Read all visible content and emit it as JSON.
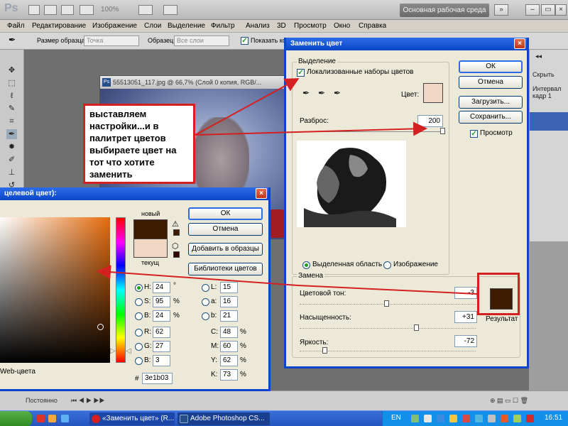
{
  "app": {
    "logo": "Ps",
    "zoom": "100%",
    "workspace": "Основная рабочая среда"
  },
  "menu": [
    "Файл",
    "Редактирование",
    "Изображение",
    "Слои",
    "Выделение",
    "Фильтр",
    "Анализ",
    "3D",
    "Просмотр",
    "Окно",
    "Справка"
  ],
  "options": {
    "sample_size_label": "Размер образца:",
    "sample_size_value": "Точка",
    "sample_label": "Образец:",
    "sample_value": "Все слои",
    "show_label": "Показать кол"
  },
  "document": {
    "title": "55513051_117.jpg @ 66,7% (Слой 0 копия, RGB/..."
  },
  "right_panel": {
    "hide": "Скрыть",
    "frame": "Интервал кадр 1"
  },
  "bottom_strip": {
    "loop": "Постоянно"
  },
  "replace_dialog": {
    "title": "Заменить цвет",
    "selection_group": "Выделение",
    "localized_label": "Локализованные наборы цветов",
    "color_label": "Цвет:",
    "color_hex": "#f2d8c4",
    "fuzziness_label": "Разброс:",
    "fuzziness_value": "200",
    "fuzziness_percent": 1.0,
    "radio_selection": "Выделенная область",
    "radio_image": "Изображение",
    "replace_group": "Замена",
    "hue_label": "Цветовой тон:",
    "hue_value": "-3",
    "hue_slider": 0.49,
    "sat_label": "Насыщенность:",
    "sat_value": "+31",
    "sat_slider": 0.66,
    "light_label": "Яркость:",
    "light_value": "-72",
    "light_slider": 0.14,
    "result_label": "Результат",
    "result_hex": "#3e1b03",
    "ok": "ОК",
    "cancel": "Отмена",
    "load": "Загрузить...",
    "save": "Сохранить...",
    "preview": "Просмотр"
  },
  "picker_dialog": {
    "title": "цвет цвет (целевой цвет):",
    "title_visible": "целевой цвет):",
    "new_label": "новый",
    "current_label": "текущ",
    "new_hex": "#3e1b03",
    "current_hex": "#f2d8c4",
    "ok": "ОК",
    "cancel": "Отмена",
    "add_swatches": "Добавить в образцы",
    "libraries": "Библиотеки цветов",
    "web_only": "Web-цвета",
    "h": "24",
    "h_unit": "°",
    "s": "95",
    "s_unit": "%",
    "b": "24",
    "b_unit": "%",
    "r": "62",
    "g": "27",
    "b2": "3",
    "l": "15",
    "a": "16",
    "b3": "21",
    "c": "48",
    "m": "60",
    "y": "62",
    "k": "73",
    "hex": "3e1b03",
    "pct": "%"
  },
  "callout": {
    "text": "выставляем настройки...и в палитрет цветов выбираете цвет на тот что хотите заменить"
  },
  "taskbar": {
    "task1": "«Заменить цвет» (R...",
    "task2": "Adobe Photoshop CS...",
    "lang": "EN",
    "time": "16:51"
  },
  "colors": {
    "xp_blue": "#0a46c8",
    "annotation_red": "#d42020"
  }
}
